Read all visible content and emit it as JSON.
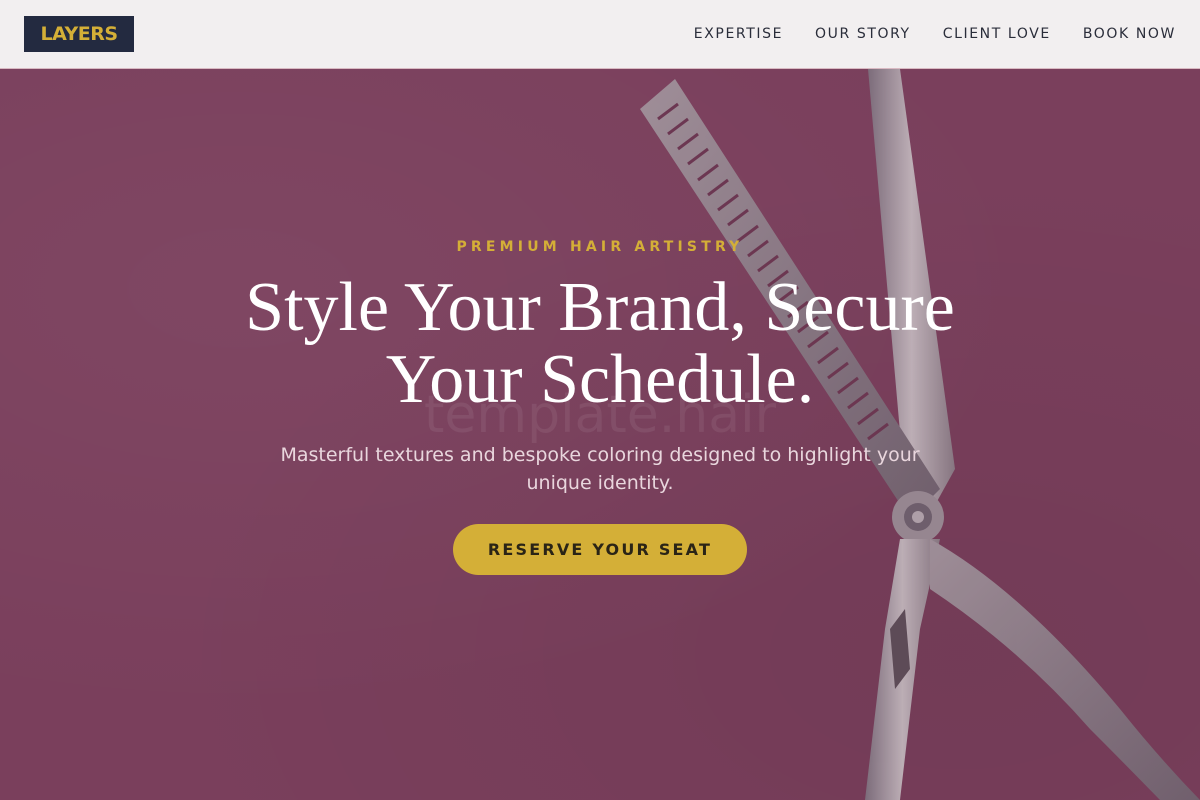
{
  "header": {
    "logo_text": "LAYERS",
    "nav": [
      {
        "label": "EXPERTISE"
      },
      {
        "label": "OUR STORY"
      },
      {
        "label": "CLIENT LOVE"
      },
      {
        "label": "BOOK NOW"
      }
    ]
  },
  "hero": {
    "eyebrow": "PREMIUM HAIR ARTISTRY",
    "headline": "Style Your Brand, Secure Your Schedule.",
    "subtext": "Masterful textures and bespoke coloring designed to highlight your unique identity.",
    "cta_label": "RESERVE YOUR SEAT",
    "watermark": "template.hair",
    "image": "thinning-shears"
  },
  "colors": {
    "accent": "#d4af37",
    "logo_bg": "#232a40",
    "hero_overlay": "#7a3f5c",
    "header_bg": "#f2eff0"
  }
}
